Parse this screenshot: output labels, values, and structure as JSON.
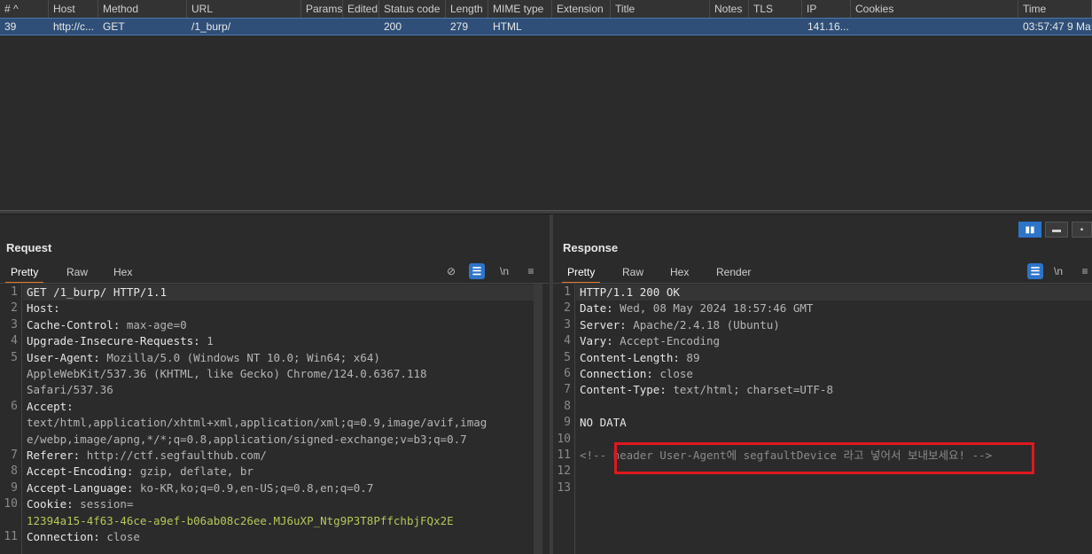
{
  "history": {
    "columns": [
      "# ^",
      "Host",
      "Method",
      "URL",
      "Params",
      "Edited",
      "Status code",
      "Length",
      "MIME type",
      "Extension",
      "Title",
      "Notes",
      "TLS",
      "IP",
      "Cookies",
      "Time"
    ],
    "row": {
      "num": "39",
      "host": "http://c...",
      "method": "GET",
      "url": "/1_burp/",
      "status": "200",
      "length": "279",
      "mime": "HTML",
      "ip": "141.16...",
      "time": "03:57:47 9 Ma"
    }
  },
  "request": {
    "title": "Request",
    "tabs": [
      "Pretty",
      "Raw",
      "Hex"
    ],
    "tools": {
      "eye_off": "⊘",
      "wrap": "☰",
      "newline": "\\n",
      "menu": "≡"
    },
    "lines": [
      {
        "n": "1",
        "name": "GET /1_burp/ HTTP/1.1",
        "value": ""
      },
      {
        "n": "2",
        "name": "Host:",
        "value": ""
      },
      {
        "n": "3",
        "name": "Cache-Control:",
        "value": " max-age=0"
      },
      {
        "n": "4",
        "name": "Upgrade-Insecure-Requests:",
        "value": " 1"
      },
      {
        "n": "5",
        "name": "User-Agent:",
        "value": " Mozilla/5.0 (Windows NT 10.0; Win64; x64)"
      },
      {
        "n": "",
        "name": "",
        "value": "AppleWebKit/537.36 (KHTML, like Gecko) Chrome/124.0.6367.118"
      },
      {
        "n": "",
        "name": "",
        "value": "Safari/537.36"
      },
      {
        "n": "6",
        "name": "Accept:",
        "value": ""
      },
      {
        "n": "",
        "name": "",
        "value": "text/html,application/xhtml+xml,application/xml;q=0.9,image/avif,imag"
      },
      {
        "n": "",
        "name": "",
        "value": "e/webp,image/apng,*/*;q=0.8,application/signed-exchange;v=b3;q=0.7"
      },
      {
        "n": "7",
        "name": "Referer:",
        "value": " http://ctf.segfaulthub.com/"
      },
      {
        "n": "8",
        "name": "Accept-Encoding:",
        "value": " gzip, deflate, br"
      },
      {
        "n": "9",
        "name": "Accept-Language:",
        "value": " ko-KR,ko;q=0.9,en-US;q=0.8,en;q=0.7"
      },
      {
        "n": "10",
        "name": "Cookie:",
        "value": " session="
      },
      {
        "n": "",
        "name": "",
        "value": "12394a15-4f63-46ce-a9ef-b06ab08c26ee.MJ6uXP_Ntg9P3T8PffchbjFQx2E",
        "green": true
      },
      {
        "n": "11",
        "name": "Connection:",
        "value": " close"
      }
    ]
  },
  "response": {
    "title": "Response",
    "tabs": [
      "Pretty",
      "Raw",
      "Hex",
      "Render"
    ],
    "tools": {
      "wrap": "☰",
      "newline": "\\n",
      "menu": "≡"
    },
    "lines": [
      {
        "n": "1",
        "name": "HTTP/1.1 200 OK",
        "value": ""
      },
      {
        "n": "2",
        "name": "Date:",
        "value": " Wed, 08 May 2024 18:57:46 GMT"
      },
      {
        "n": "3",
        "name": "Server:",
        "value": " Apache/2.4.18 (Ubuntu)"
      },
      {
        "n": "4",
        "name": "Vary:",
        "value": " Accept-Encoding"
      },
      {
        "n": "5",
        "name": "Content-Length:",
        "value": " 89"
      },
      {
        "n": "6",
        "name": "Connection:",
        "value": " close"
      },
      {
        "n": "7",
        "name": "Content-Type:",
        "value": " text/html; charset=UTF-8"
      },
      {
        "n": "8",
        "name": "",
        "value": ""
      },
      {
        "n": "9",
        "name": "NO DATA",
        "value": ""
      },
      {
        "n": "10",
        "name": "",
        "value": ""
      },
      {
        "n": "11",
        "name": "",
        "value": "<!-- header User-Agent에 segfaultDevice 라고 넣어서 보내보세요! -->",
        "comment": true
      },
      {
        "n": "12",
        "name": "",
        "value": ""
      },
      {
        "n": "13",
        "name": "",
        "value": ""
      }
    ]
  },
  "view_buttons": [
    "▮▮",
    "▬",
    "▪"
  ],
  "colors": {
    "accent": "#2e74c8",
    "tab_active": "#e0792b",
    "highlight_box": "#e0181f",
    "selected_row": "#2f4f78"
  }
}
